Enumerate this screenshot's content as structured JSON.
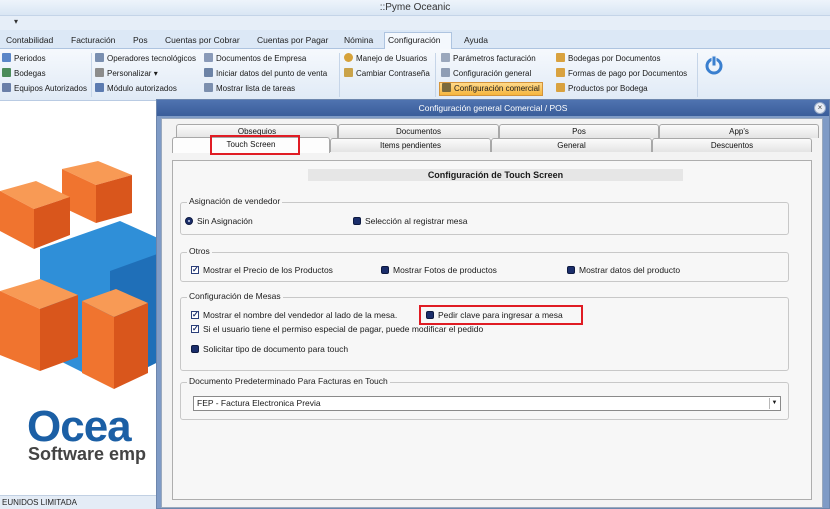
{
  "app": {
    "title": "::Pyme Oceanic",
    "qat_arrow": "▾"
  },
  "ribbon_tabs": [
    "Contabilidad",
    "Facturación",
    "Pos",
    "Cuentas por Cobrar",
    "Cuentas por Pagar",
    "Nómina",
    "Configuración",
    "Ayuda"
  ],
  "active_tab": "Configuración",
  "ribbon": {
    "col1": [
      "Periodos",
      "Bodegas",
      "Equipos Autorizados"
    ],
    "col2": [
      "Operadores tecnológicos",
      "Personalizar ▾",
      "Módulo autorizados"
    ],
    "col3": [
      "Documentos de Empresa",
      "Iniciar datos del punto de venta",
      "Mostrar lista de tareas"
    ],
    "col4": [
      "Manejo de Usuarios",
      "Cambiar Contraseña"
    ],
    "col5": [
      "Parámetros facturación",
      "Configuración general",
      "Configuración comercial"
    ],
    "col6": [
      "Bodegas por Documentos",
      "Formas de pago por Documentos",
      "Productos por Bodega"
    ]
  },
  "brand": {
    "name": "Ocea",
    "subtitle": "Software emp"
  },
  "status": {
    "company": "EUNIDOS LIMITADA"
  },
  "dialog": {
    "title": "Configuración general Comercial / POS",
    "close": "×",
    "tabs_top": [
      "Obsequios",
      "Documentos",
      "Pos",
      "App's"
    ],
    "tabs_bottom": [
      "Touch Screen",
      "Items pendientes",
      "General",
      "Descuentos"
    ],
    "panel_title": "Configuración de Touch Screen",
    "vendedor": {
      "legend": "Asignación de vendedor",
      "options": [
        "Sin Asignación",
        "Selección al registrar mesa"
      ]
    },
    "otros": {
      "legend": "Otros",
      "options": [
        "Mostrar el Precio de los Productos",
        "Mostrar Fotos de productos",
        "Mostrar datos del producto"
      ]
    },
    "mesas": {
      "legend": "Configuración de Mesas",
      "options": [
        "Mostrar el nombre del vendedor al lado de la mesa.",
        "Pedir clave para ingresar a mesa",
        "Si el usuario tiene el permiso especial de pagar, puede modificar el pedido",
        "Solicitar tipo de documento para touch"
      ]
    },
    "documento": {
      "legend": "Documento Predeterminado Para Facturas en Touch",
      "value": "FEP - Factura Electronica Previa"
    }
  },
  "colors": {
    "highlight_red": "#e01c24",
    "ribbon_active": "#f6b53d",
    "brand_blue": "#1b5fa5"
  }
}
